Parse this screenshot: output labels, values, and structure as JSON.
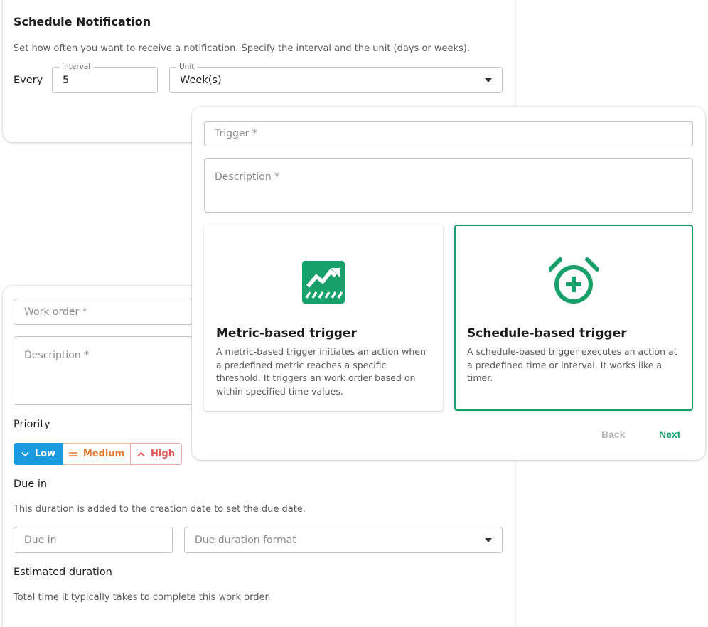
{
  "schedule": {
    "title": "Schedule Notification",
    "description": "Set how often you want to receive a notification. Specify the interval and the unit (days or weeks).",
    "every_label": "Every",
    "interval": {
      "label": "Interval",
      "value": "5"
    },
    "unit": {
      "label": "Unit",
      "value": "Week(s)"
    }
  },
  "work_order": {
    "work_order_placeholder": "Work order *",
    "description_placeholder": "Description *",
    "priority_label": "Priority",
    "priority_options": [
      {
        "label": "Low",
        "icon": "chevron-down-icon",
        "selected": true
      },
      {
        "label": "Medium",
        "icon": "equals-icon",
        "selected": false
      },
      {
        "label": "High",
        "icon": "chevron-up-icon",
        "selected": false
      }
    ],
    "due_in_label": "Due in",
    "due_in_description": "This duration is added to the creation date to set the due date.",
    "due_in_placeholder": "Due in",
    "due_format_placeholder": "Due duration format",
    "estimated_label": "Estimated duration",
    "estimated_description": "Total time it typically takes to complete this work order."
  },
  "trigger_dialog": {
    "trigger_placeholder": "Trigger *",
    "description_placeholder": "Description *",
    "options": [
      {
        "icon": "metric-chart-icon",
        "title": "Metric-based trigger",
        "description": "A metric-based trigger initiates an action when a predefined metric reaches a specific threshold. It triggers an work order based on within specified time values.",
        "selected": false
      },
      {
        "icon": "alarm-clock-icon",
        "title": "Schedule-based trigger",
        "description": "A schedule-based trigger executes an action at a predefined time or interval. It works like a timer.",
        "selected": true
      }
    ],
    "back_label": "Back",
    "next_label": "Next"
  },
  "colors": {
    "accent_green": "#18a06a",
    "low_blue": "#1a9be0",
    "medium_orange": "#e57a2e",
    "high_red": "#e25555",
    "disabled": "#b8b8b8"
  }
}
